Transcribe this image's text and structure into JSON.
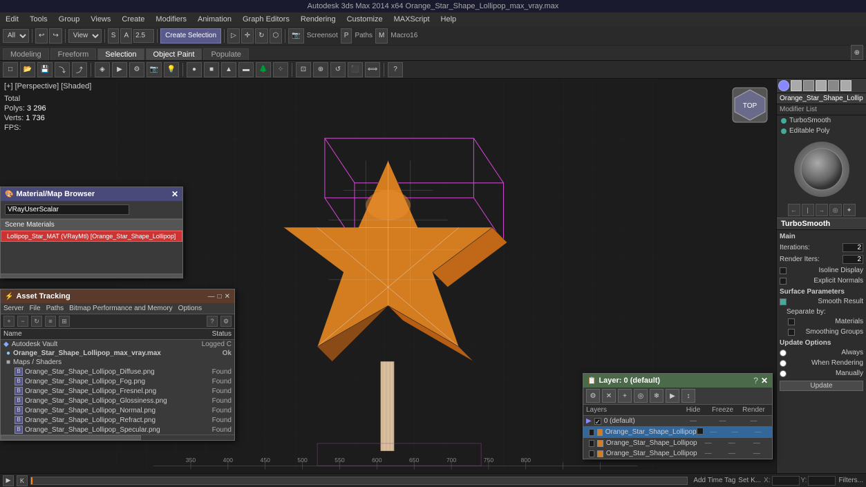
{
  "titlebar": {
    "text": "Autodesk 3ds Max  2014 x64    Orange_Star_Shape_Lollipop_max_vray.max"
  },
  "menubar": {
    "items": [
      "Edit",
      "Tools",
      "Group",
      "Views",
      "Create",
      "Modifiers",
      "Animation",
      "Graph Editors",
      "Rendering",
      "Customize",
      "MAXScript",
      "Help"
    ]
  },
  "toolbar1": {
    "dropdown_all": "All",
    "dropdown_view": "View",
    "value_25": "2.5",
    "create_selection": "Create Selection",
    "screenshot": "Screensot",
    "paths": "Paths",
    "macro16": "Macro16"
  },
  "tabbar": {
    "tabs": [
      "Modeling",
      "Freeform",
      "Selection",
      "Object Paint",
      "Populate"
    ]
  },
  "viewport": {
    "label": "[+] [Perspective] [Shaded]",
    "stats": {
      "total": "Total",
      "polys_label": "Polys:",
      "polys_value": "3 296",
      "verts_label": "Verts:",
      "verts_value": "1 736",
      "fps_label": "FPS:"
    }
  },
  "rightpanel": {
    "object_name": "Orange_Star_Shape_Lollip",
    "modifier_list_label": "Modifier List",
    "modifiers": [
      {
        "name": "TurboSmooth"
      },
      {
        "name": "Editable Poly"
      }
    ]
  },
  "turbossmooth": {
    "title": "TurboSmooth",
    "main_label": "Main",
    "iterations_label": "Iterations:",
    "iterations_value": "2",
    "render_iters_label": "Render Iters:",
    "render_iters_value": "2",
    "isoline_display": "Isoline Display",
    "explicit_normals": "Explicit Normals",
    "surface_params": "Surface Parameters",
    "smooth_result": "Smooth Result",
    "separate_by": "Separate by:",
    "materials": "Materials",
    "smoothing_groups": "Smoothing Groups",
    "update_options": "Update Options",
    "always": "Always",
    "when_rendering": "When Rendering",
    "manually": "Manually",
    "update_btn": "Update"
  },
  "mat_browser": {
    "title": "Material/Map Browser",
    "search_text": "VRayUserScalar",
    "scene_materials": "Scene Materials",
    "item": "Lollipop_Star_MAT (VRayMtl) [Orange_Star_Shape_Lollipop]"
  },
  "asset_tracking": {
    "title": "Asset Tracking",
    "menus": [
      "Server",
      "File",
      "Paths",
      "Bitmap Performance and Memory",
      "Options"
    ],
    "headers": {
      "name": "Name",
      "status": "Status"
    },
    "rows": [
      {
        "indent": 0,
        "icon": "◆",
        "name": "Autodesk Vault",
        "status": "Logged C"
      },
      {
        "indent": 1,
        "icon": "●",
        "name": "Orange_Star_Shape_Lollipop_max_vray.max",
        "status": "Ok"
      },
      {
        "indent": 1,
        "icon": "■",
        "name": "Maps / Shaders",
        "status": ""
      },
      {
        "indent": 2,
        "icon": "□",
        "name": "Orange_Star_Shape_Lollipop_Diffuse.png",
        "status": "Found"
      },
      {
        "indent": 2,
        "icon": "□",
        "name": "Orange_Star_Shape_Lollipop_Fog.png",
        "status": "Found"
      },
      {
        "indent": 2,
        "icon": "□",
        "name": "Orange_Star_Shape_Lollipop_Fresnel.png",
        "status": "Found"
      },
      {
        "indent": 2,
        "icon": "□",
        "name": "Orange_Star_Shape_Lollipop_Glossiness.png",
        "status": "Found"
      },
      {
        "indent": 2,
        "icon": "□",
        "name": "Orange_Star_Shape_Lollipop_Normal.png",
        "status": "Found"
      },
      {
        "indent": 2,
        "icon": "□",
        "name": "Orange_Star_Shape_Lollipop_Refract.png",
        "status": "Found"
      },
      {
        "indent": 2,
        "icon": "□",
        "name": "Orange_Star_Shape_Lollipop_Specular.png",
        "status": "Found"
      }
    ]
  },
  "layer_panel": {
    "title": "Layer: 0 (default)",
    "headers": {
      "name": "Layers",
      "hide": "Hide",
      "freeze": "Freeze",
      "render": "Render"
    },
    "rows": [
      {
        "indent": 0,
        "name": "0 (default)",
        "hide": "—",
        "freeze": "—",
        "render": "—",
        "selected": false,
        "check": true
      },
      {
        "indent": 1,
        "name": "Orange_Star_Shape_Lollipop",
        "hide": "—",
        "freeze": "—",
        "render": "—",
        "selected": true,
        "check": false
      },
      {
        "indent": 1,
        "name": "Orange_Star_Shape_Lollipop",
        "hide": "—",
        "freeze": "—",
        "render": "—",
        "selected": false,
        "check": false
      },
      {
        "indent": 1,
        "name": "Orange_Star_Shape_Lollipop",
        "hide": "—",
        "freeze": "—",
        "render": "—",
        "selected": false,
        "check": false
      }
    ]
  },
  "bottombar": {
    "x_label": "X:",
    "y_label": "Y:",
    "add_time_tag": "Add Time Tag",
    "set_k": "Set K...",
    "filters": "Filters..."
  }
}
